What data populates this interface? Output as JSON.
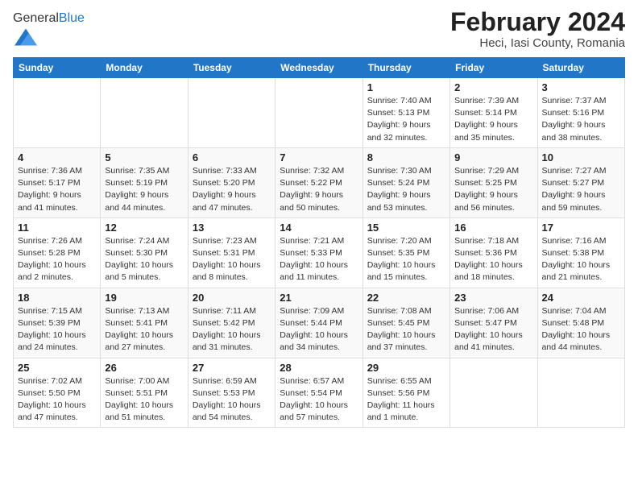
{
  "header": {
    "logo_general": "General",
    "logo_blue": "Blue",
    "title": "February 2024",
    "subtitle": "Heci, Iasi County, Romania"
  },
  "days_of_week": [
    "Sunday",
    "Monday",
    "Tuesday",
    "Wednesday",
    "Thursday",
    "Friday",
    "Saturday"
  ],
  "weeks": [
    [
      {
        "day": "",
        "sunrise": "",
        "sunset": "",
        "daylight": ""
      },
      {
        "day": "",
        "sunrise": "",
        "sunset": "",
        "daylight": ""
      },
      {
        "day": "",
        "sunrise": "",
        "sunset": "",
        "daylight": ""
      },
      {
        "day": "",
        "sunrise": "",
        "sunset": "",
        "daylight": ""
      },
      {
        "day": "1",
        "sunrise": "Sunrise: 7:40 AM",
        "sunset": "Sunset: 5:13 PM",
        "daylight": "Daylight: 9 hours and 32 minutes."
      },
      {
        "day": "2",
        "sunrise": "Sunrise: 7:39 AM",
        "sunset": "Sunset: 5:14 PM",
        "daylight": "Daylight: 9 hours and 35 minutes."
      },
      {
        "day": "3",
        "sunrise": "Sunrise: 7:37 AM",
        "sunset": "Sunset: 5:16 PM",
        "daylight": "Daylight: 9 hours and 38 minutes."
      }
    ],
    [
      {
        "day": "4",
        "sunrise": "Sunrise: 7:36 AM",
        "sunset": "Sunset: 5:17 PM",
        "daylight": "Daylight: 9 hours and 41 minutes."
      },
      {
        "day": "5",
        "sunrise": "Sunrise: 7:35 AM",
        "sunset": "Sunset: 5:19 PM",
        "daylight": "Daylight: 9 hours and 44 minutes."
      },
      {
        "day": "6",
        "sunrise": "Sunrise: 7:33 AM",
        "sunset": "Sunset: 5:20 PM",
        "daylight": "Daylight: 9 hours and 47 minutes."
      },
      {
        "day": "7",
        "sunrise": "Sunrise: 7:32 AM",
        "sunset": "Sunset: 5:22 PM",
        "daylight": "Daylight: 9 hours and 50 minutes."
      },
      {
        "day": "8",
        "sunrise": "Sunrise: 7:30 AM",
        "sunset": "Sunset: 5:24 PM",
        "daylight": "Daylight: 9 hours and 53 minutes."
      },
      {
        "day": "9",
        "sunrise": "Sunrise: 7:29 AM",
        "sunset": "Sunset: 5:25 PM",
        "daylight": "Daylight: 9 hours and 56 minutes."
      },
      {
        "day": "10",
        "sunrise": "Sunrise: 7:27 AM",
        "sunset": "Sunset: 5:27 PM",
        "daylight": "Daylight: 9 hours and 59 minutes."
      }
    ],
    [
      {
        "day": "11",
        "sunrise": "Sunrise: 7:26 AM",
        "sunset": "Sunset: 5:28 PM",
        "daylight": "Daylight: 10 hours and 2 minutes."
      },
      {
        "day": "12",
        "sunrise": "Sunrise: 7:24 AM",
        "sunset": "Sunset: 5:30 PM",
        "daylight": "Daylight: 10 hours and 5 minutes."
      },
      {
        "day": "13",
        "sunrise": "Sunrise: 7:23 AM",
        "sunset": "Sunset: 5:31 PM",
        "daylight": "Daylight: 10 hours and 8 minutes."
      },
      {
        "day": "14",
        "sunrise": "Sunrise: 7:21 AM",
        "sunset": "Sunset: 5:33 PM",
        "daylight": "Daylight: 10 hours and 11 minutes."
      },
      {
        "day": "15",
        "sunrise": "Sunrise: 7:20 AM",
        "sunset": "Sunset: 5:35 PM",
        "daylight": "Daylight: 10 hours and 15 minutes."
      },
      {
        "day": "16",
        "sunrise": "Sunrise: 7:18 AM",
        "sunset": "Sunset: 5:36 PM",
        "daylight": "Daylight: 10 hours and 18 minutes."
      },
      {
        "day": "17",
        "sunrise": "Sunrise: 7:16 AM",
        "sunset": "Sunset: 5:38 PM",
        "daylight": "Daylight: 10 hours and 21 minutes."
      }
    ],
    [
      {
        "day": "18",
        "sunrise": "Sunrise: 7:15 AM",
        "sunset": "Sunset: 5:39 PM",
        "daylight": "Daylight: 10 hours and 24 minutes."
      },
      {
        "day": "19",
        "sunrise": "Sunrise: 7:13 AM",
        "sunset": "Sunset: 5:41 PM",
        "daylight": "Daylight: 10 hours and 27 minutes."
      },
      {
        "day": "20",
        "sunrise": "Sunrise: 7:11 AM",
        "sunset": "Sunset: 5:42 PM",
        "daylight": "Daylight: 10 hours and 31 minutes."
      },
      {
        "day": "21",
        "sunrise": "Sunrise: 7:09 AM",
        "sunset": "Sunset: 5:44 PM",
        "daylight": "Daylight: 10 hours and 34 minutes."
      },
      {
        "day": "22",
        "sunrise": "Sunrise: 7:08 AM",
        "sunset": "Sunset: 5:45 PM",
        "daylight": "Daylight: 10 hours and 37 minutes."
      },
      {
        "day": "23",
        "sunrise": "Sunrise: 7:06 AM",
        "sunset": "Sunset: 5:47 PM",
        "daylight": "Daylight: 10 hours and 41 minutes."
      },
      {
        "day": "24",
        "sunrise": "Sunrise: 7:04 AM",
        "sunset": "Sunset: 5:48 PM",
        "daylight": "Daylight: 10 hours and 44 minutes."
      }
    ],
    [
      {
        "day": "25",
        "sunrise": "Sunrise: 7:02 AM",
        "sunset": "Sunset: 5:50 PM",
        "daylight": "Daylight: 10 hours and 47 minutes."
      },
      {
        "day": "26",
        "sunrise": "Sunrise: 7:00 AM",
        "sunset": "Sunset: 5:51 PM",
        "daylight": "Daylight: 10 hours and 51 minutes."
      },
      {
        "day": "27",
        "sunrise": "Sunrise: 6:59 AM",
        "sunset": "Sunset: 5:53 PM",
        "daylight": "Daylight: 10 hours and 54 minutes."
      },
      {
        "day": "28",
        "sunrise": "Sunrise: 6:57 AM",
        "sunset": "Sunset: 5:54 PM",
        "daylight": "Daylight: 10 hours and 57 minutes."
      },
      {
        "day": "29",
        "sunrise": "Sunrise: 6:55 AM",
        "sunset": "Sunset: 5:56 PM",
        "daylight": "Daylight: 11 hours and 1 minute."
      },
      {
        "day": "",
        "sunrise": "",
        "sunset": "",
        "daylight": ""
      },
      {
        "day": "",
        "sunrise": "",
        "sunset": "",
        "daylight": ""
      }
    ]
  ]
}
